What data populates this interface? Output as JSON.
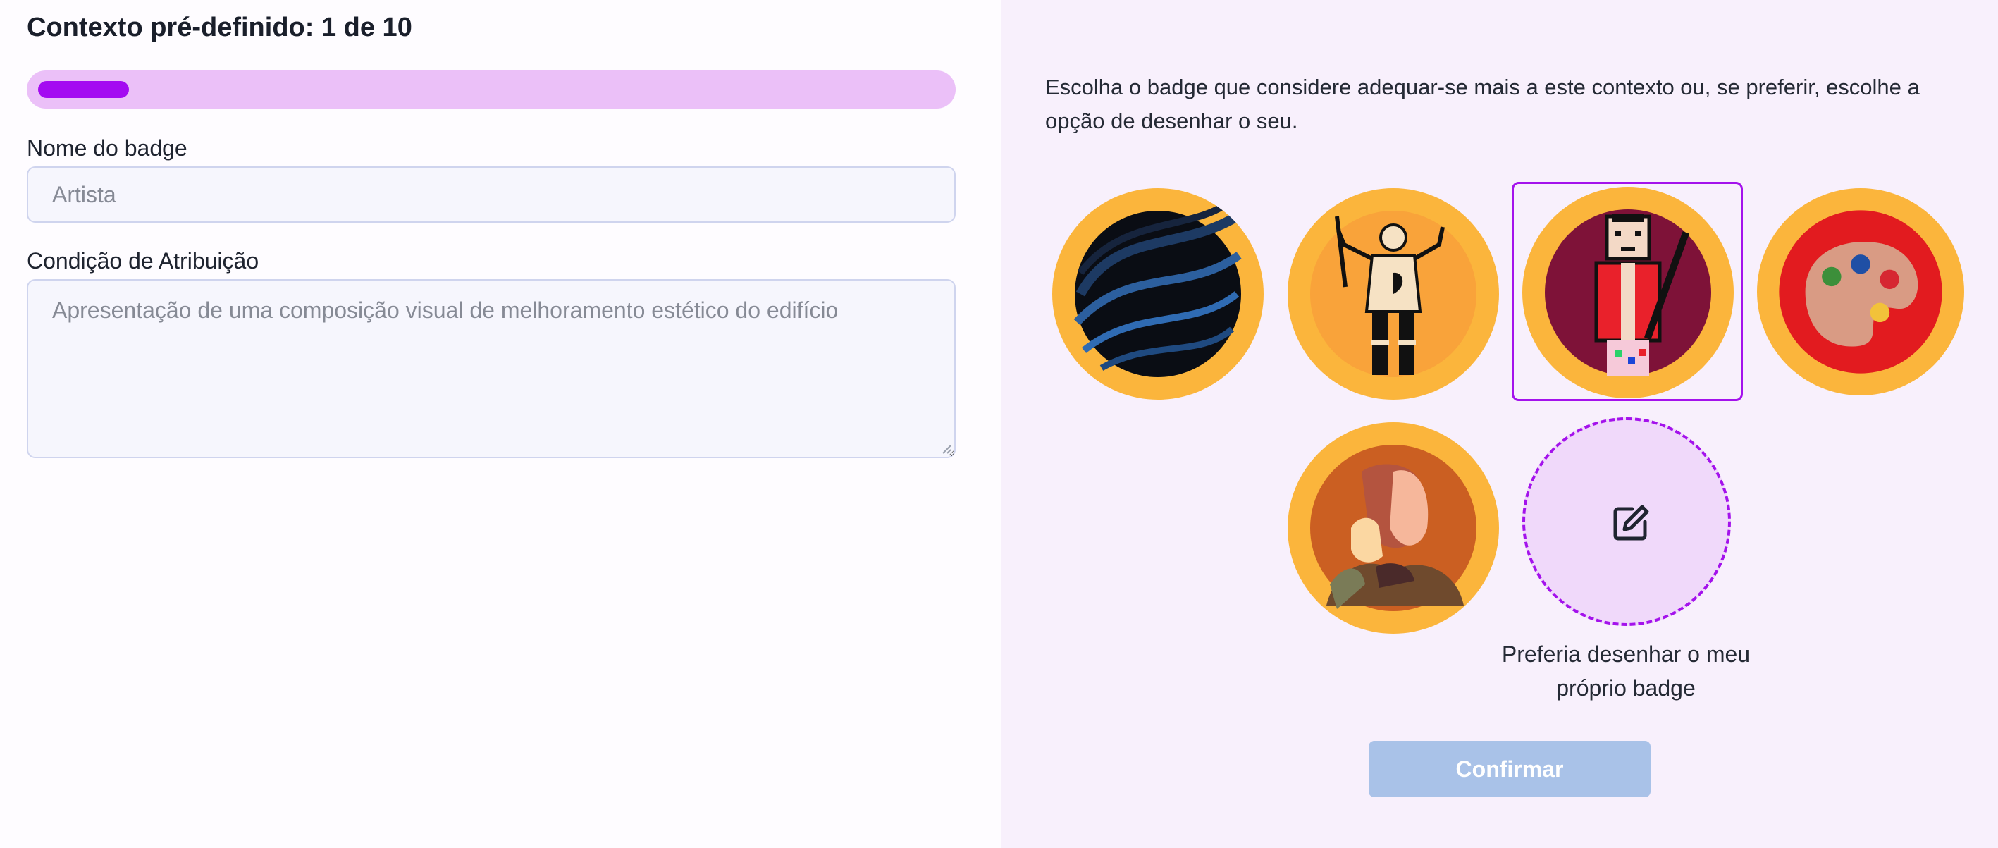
{
  "header": {
    "title": "Contexto pré-definido: 1 de 10",
    "progress": 0.1
  },
  "form": {
    "name_label": "Nome do badge",
    "name_placeholder": "Artista",
    "condition_label": "Condição de Atribuição",
    "condition_placeholder": "Apresentação de uma composição visual de melhoramento estético do edifício"
  },
  "selection": {
    "instructions": "Escolha o badge que considere adequar-se mais a este contexto ou, se preferir, escolhe a opção de desenhar o seu.",
    "badges": [
      {
        "icon": "dark-waves-badge-icon",
        "selected": false
      },
      {
        "icon": "painter-figure-badge-icon",
        "selected": false
      },
      {
        "icon": "pixel-artist-badge-icon",
        "selected": true
      },
      {
        "icon": "paint-palette-badge-icon",
        "selected": false
      },
      {
        "icon": "thinking-person-badge-icon",
        "selected": false
      }
    ],
    "draw_own_icon": "edit-icon",
    "draw_own_label": "Preferia desenhar o meu próprio badge",
    "confirm_label": "Confirmar"
  },
  "colors": {
    "accent": "#a40bf1",
    "progress_track": "#ebc0f8",
    "badge_ring": "#fbb53c",
    "confirm_disabled": "#a9c2e8",
    "right_panel_bg": "#f8f0fc"
  }
}
